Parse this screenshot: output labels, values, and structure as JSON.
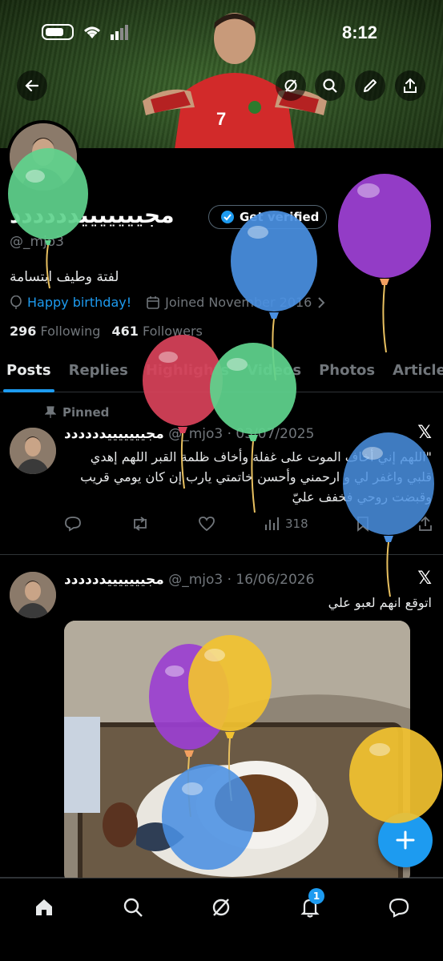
{
  "status": {
    "time": "8:12"
  },
  "profile": {
    "name": "مجيييييييدددددد",
    "get_verified": "Get verified",
    "handle": "@_mjo3",
    "bio": "لفتة وطيف ابتسامة",
    "birthday": "Happy birthday!",
    "joined": "Joined November 2016",
    "following_count": "296",
    "following_label": "Following",
    "followers_count": "461",
    "followers_label": "Followers"
  },
  "tabs": [
    "Posts",
    "Replies",
    "Highlights",
    "Videos",
    "Photos",
    "Articles"
  ],
  "posts": [
    {
      "pinned_label": "Pinned",
      "name": "مجيييييييدددددد",
      "handle": "@_mjo3",
      "date": "03/07/2025",
      "text": "\"اللهم إني أخاف الموت على غفلة وأخاف ظلمة القبر اللهم إهدي قلبي واغفر لي و ارحمني وأحسن خاتمتي يارب إن كان يومي قريب وقبضت روحي فخفف عليّ",
      "views": "318"
    },
    {
      "name": "مجيييييييدددددد",
      "handle": "@_mjo3",
      "date": "16/06/2026",
      "text": "اتوقع انهم لعبو علي"
    }
  ],
  "nav": {
    "notifications_badge": "1"
  },
  "colors": {
    "accent": "#1d9bf0",
    "background": "#000000"
  },
  "balloon_colors": [
    "#5fd38d",
    "#9b3fd1",
    "#4a90e2",
    "#d9425a",
    "#5fd38d",
    "#4a90e2",
    "#9b3fd1",
    "#f2c230",
    "#4a90e2",
    "#f2c230"
  ]
}
